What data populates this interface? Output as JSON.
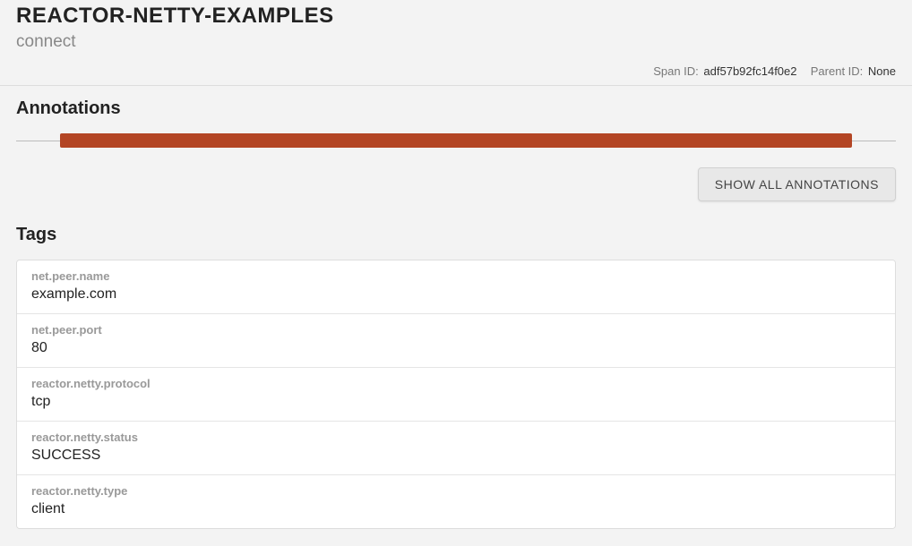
{
  "header": {
    "title": "REACTOR-NETTY-EXAMPLES",
    "subtitle": "connect"
  },
  "meta": {
    "span_id_label": "Span ID:",
    "span_id_value": "adf57b92fc14f0e2",
    "parent_id_label": "Parent ID:",
    "parent_id_value": "None"
  },
  "annotations": {
    "heading": "Annotations",
    "show_all_label": "SHOW ALL ANNOTATIONS"
  },
  "tags_section": {
    "heading": "Tags",
    "items": [
      {
        "key": "net.peer.name",
        "value": "example.com"
      },
      {
        "key": "net.peer.port",
        "value": "80"
      },
      {
        "key": "reactor.netty.protocol",
        "value": "tcp"
      },
      {
        "key": "reactor.netty.status",
        "value": "SUCCESS"
      },
      {
        "key": "reactor.netty.type",
        "value": "client"
      }
    ]
  }
}
